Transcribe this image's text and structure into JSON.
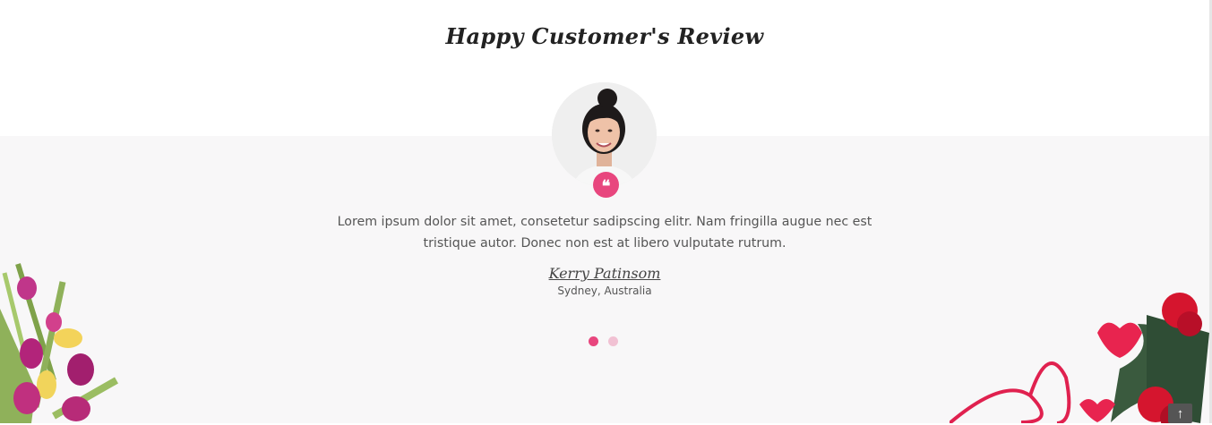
{
  "section": {
    "title": "Happy Customer's Review"
  },
  "review": {
    "avatar_icon": "customer-photo",
    "quote_icon": "quote-icon",
    "quote_glyph": "❝",
    "text": "Lorem ipsum dolor sit amet, consetetur sadipscing elitr. Nam fringilla augue nec est tristique autor. Donec non est at libero vulputate rutrum.",
    "name": "Kerry Patinsom",
    "location": "Sydney, Australia"
  },
  "carousel": {
    "active_index": 0,
    "total": 2,
    "active_color": "#e8467e",
    "inactive_color": "#f1c1d3"
  },
  "back_to_top": {
    "icon": "arrow-up-icon",
    "glyph": "↑"
  },
  "colors": {
    "accent": "#e8467e",
    "band_background": "#f8f7f8"
  }
}
